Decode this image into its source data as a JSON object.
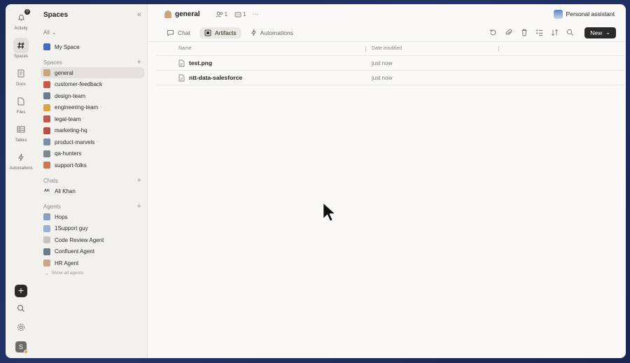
{
  "rail": {
    "items": [
      {
        "label": "Activity",
        "icon": "bell-icon",
        "badge": "0"
      },
      {
        "label": "Spaces",
        "icon": "hash-icon"
      },
      {
        "label": "Docs",
        "icon": "doc-icon"
      },
      {
        "label": "Files",
        "icon": "file-icon"
      },
      {
        "label": "Tables",
        "icon": "table-icon"
      },
      {
        "label": "Automations",
        "icon": "bolt-icon"
      }
    ],
    "avatar_initial": "S"
  },
  "sidebar": {
    "title": "Spaces",
    "filter": "All",
    "my_space": "My Space",
    "spaces_header": "Spaces",
    "spaces": [
      {
        "label": "general",
        "color": "#c9a77c"
      },
      {
        "label": "customer-feedback",
        "color": "#c8584b"
      },
      {
        "label": "design-team",
        "color": "#6d7b8f"
      },
      {
        "label": "engineering-team",
        "color": "#d9a441"
      },
      {
        "label": "legal-team",
        "color": "#c2574f"
      },
      {
        "label": "marketing-hq",
        "color": "#b84e48"
      },
      {
        "label": "product-marvels",
        "color": "#7a8ea8"
      },
      {
        "label": "qa-hunters",
        "color": "#7d8794"
      },
      {
        "label": "support-folks",
        "color": "#c77a52"
      }
    ],
    "chats_header": "Chats",
    "chats": [
      {
        "label": "Ali Khan",
        "initials": "AK"
      }
    ],
    "agents_header": "Agents",
    "agents": [
      {
        "label": "Hops"
      },
      {
        "label": "1Support guy"
      },
      {
        "label": "Code Review Agent"
      },
      {
        "label": "Confluent Agent"
      },
      {
        "label": "HR Agent"
      }
    ],
    "show_all": "Show all agents"
  },
  "topbar": {
    "space_name": "general",
    "members_count": "1",
    "bots_count": "1",
    "more": "···",
    "assistant_label": "Personal assistant"
  },
  "tabs": [
    {
      "label": "Chat",
      "icon": "chat-icon"
    },
    {
      "label": "Artifacts",
      "icon": "artifact-icon"
    },
    {
      "label": "Automations",
      "icon": "bolt-icon"
    }
  ],
  "new_button": "New",
  "table": {
    "headers": {
      "name": "Name",
      "date": "Date modified"
    },
    "rows": [
      {
        "name": "test.png",
        "date": "just now"
      },
      {
        "name": "ntt-data-salesforce",
        "date": "just now"
      }
    ]
  }
}
